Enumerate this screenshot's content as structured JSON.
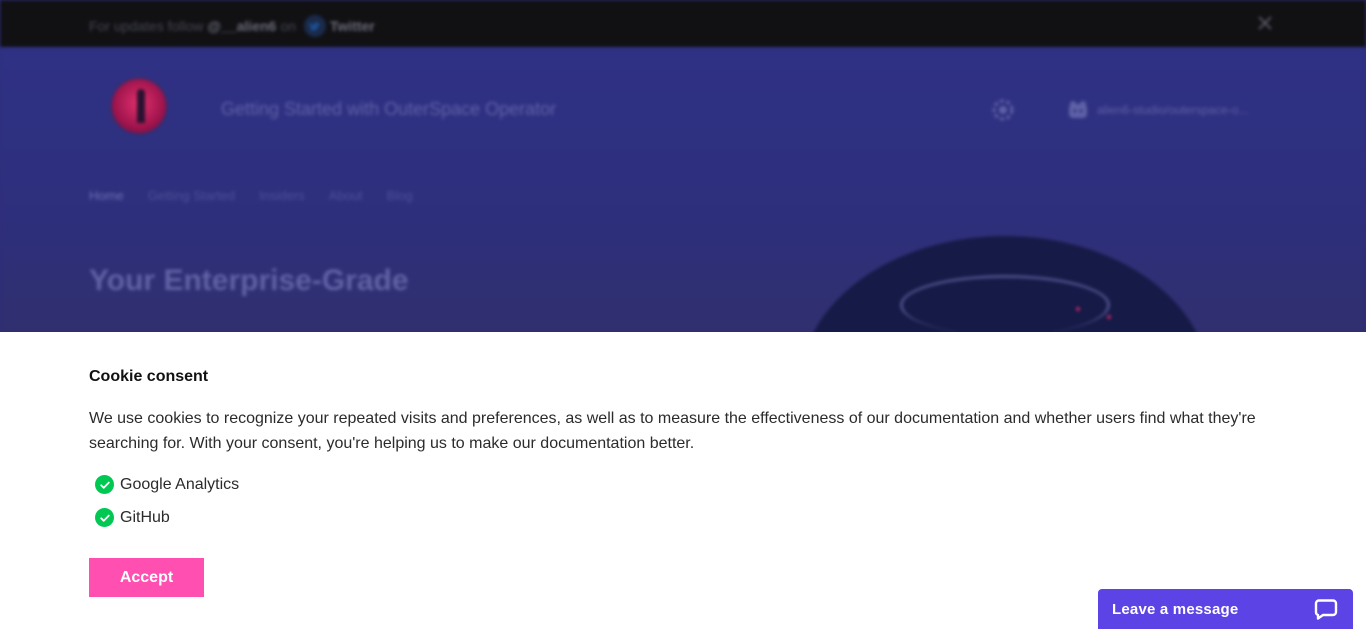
{
  "announcement": {
    "prefix": "For updates follow",
    "handle": "@__alien6",
    "on": "on",
    "platform": "Twitter",
    "icon": "twitter-icon",
    "close_icon": "close-icon"
  },
  "header": {
    "site_title": "Getting Started with OuterSpace Operator",
    "theme_icon": "gear-icon",
    "repo_label": "alien6-studio/outerspace-o...",
    "repo_icon": "github-icon"
  },
  "nav": {
    "items": [
      {
        "label": "Home"
      },
      {
        "label": "Getting Started"
      },
      {
        "label": "Insiders"
      },
      {
        "label": "About"
      },
      {
        "label": "Blog"
      }
    ]
  },
  "hero": {
    "title": "Your Enterprise-Grade"
  },
  "cookie_consent": {
    "title": "Cookie consent",
    "text": "We use cookies to recognize your repeated visits and preferences, as well as to measure the effectiveness of our documentation and whether users find what they're searching for. With your consent, you're helping us to make our documentation better.",
    "options": [
      {
        "label": "Google Analytics",
        "checked": true
      },
      {
        "label": "GitHub",
        "checked": true
      }
    ],
    "accept_label": "Accept",
    "accent_color": "#ff4fb1",
    "check_color": "#00c853"
  },
  "chat": {
    "label": "Leave a message",
    "icon": "chat-bubble-icon",
    "color": "#5b43e6"
  }
}
